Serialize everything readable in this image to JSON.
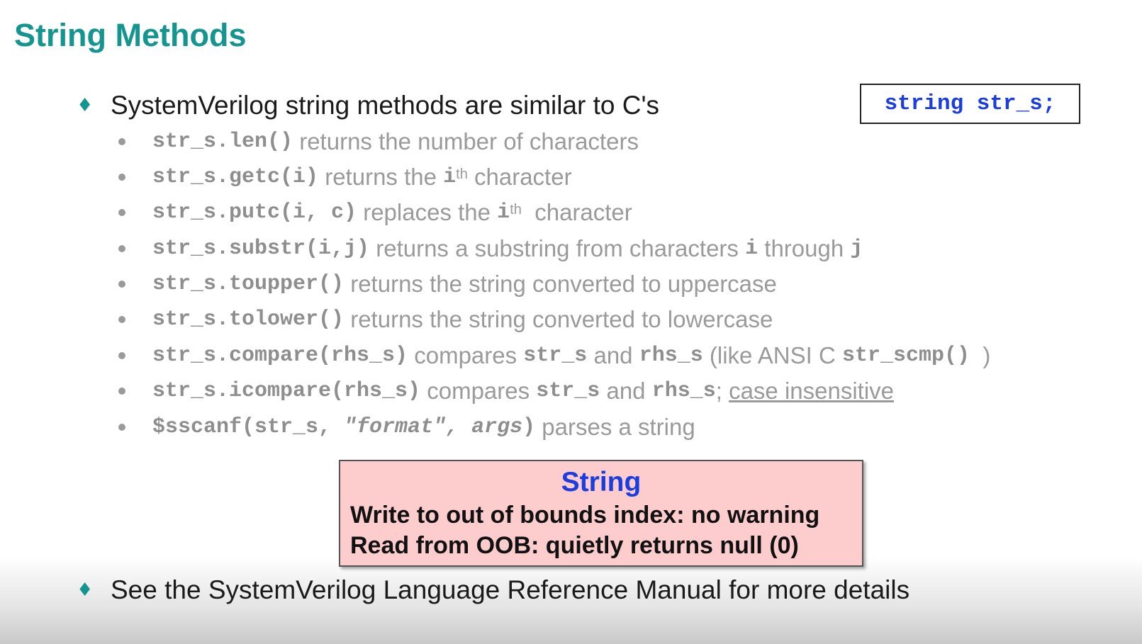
{
  "slide": {
    "title": "String Methods",
    "code_box": "string str_s;",
    "main_bullet": "SystemVerilog string methods are similar to C's",
    "sub_bullets": [
      {
        "code": "str_s.len()",
        "text": " returns the number of characters"
      },
      {
        "code": "str_s.getc(i)",
        "text1": " returns the ",
        "var": "i",
        "sup": "th",
        "text2": " character"
      },
      {
        "code": "str_s.putc(i, c)",
        "text1": " replaces the ",
        "var": "i",
        "sup": "th",
        "text2": "  character"
      },
      {
        "code": "str_s.substr(i,j)",
        "text1": " returns a substring from characters ",
        "var1": "i",
        "text2": " through ",
        "var2": "j"
      },
      {
        "code": "str_s.toupper()",
        "text": " returns the string converted to uppercase"
      },
      {
        "code": "str_s.tolower()",
        "text": " returns the string converted to lowercase"
      },
      {
        "code": "str_s.compare(rhs_s)",
        "text1": " compares ",
        "code2": "str_s",
        "text2": " and ",
        "code3": "rhs_s",
        "text3": " (like ANSI C ",
        "code4": "str_scmp()",
        "text4": "  )"
      },
      {
        "code": "str_s.icompare(rhs_s)",
        "text1": " compares ",
        "code2": "str_s",
        "text2": " and ",
        "code3": "rhs_s",
        "text3": "; ",
        "underlined": "case insensitive"
      },
      {
        "code_a": "$sscanf(str_s, ",
        "code_b": "\"format\", args",
        "code_c": ")",
        "text": " parses a string"
      }
    ],
    "warning": {
      "title": "String",
      "line1": "Write to out of bounds index: no warning",
      "line2": "Read from OOB: quietly returns null (0)"
    },
    "footer_bullet": "See the SystemVerilog Language Reference Manual for more details"
  },
  "colors": {
    "title": "#14958f",
    "code_blue": "#1b3de0",
    "sub_text": "#9a9a9a",
    "warning_bg": "#fdcccc"
  }
}
